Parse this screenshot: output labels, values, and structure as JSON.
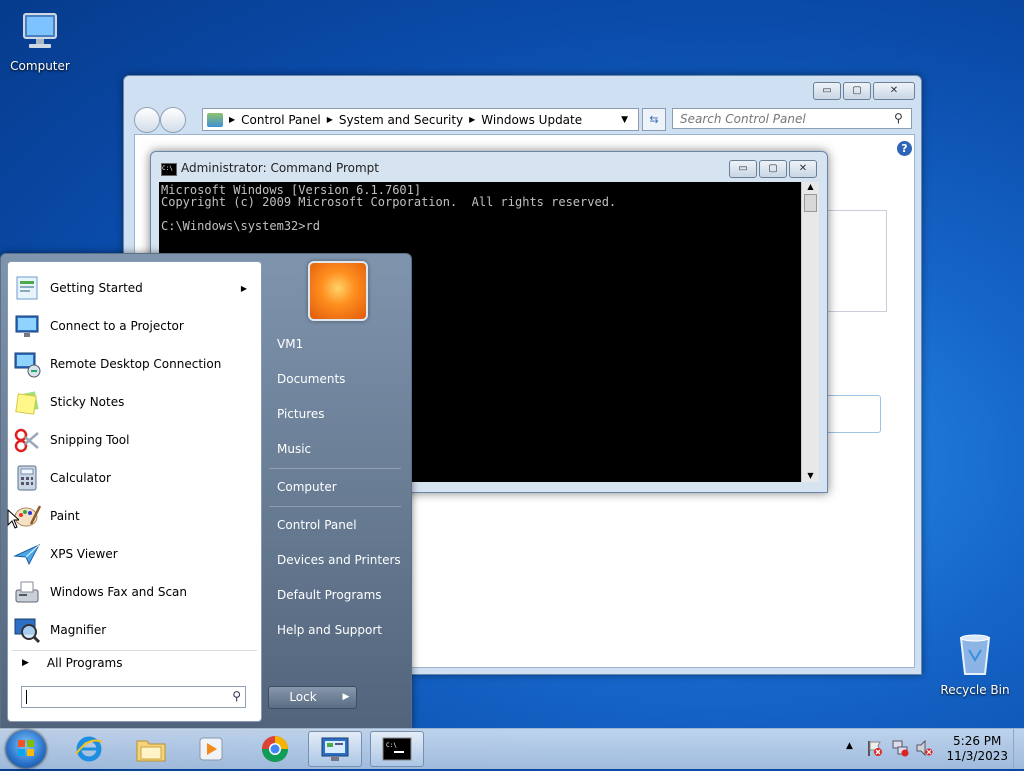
{
  "desktop": {
    "icons": {
      "computer": "Computer",
      "recycle_bin": "Recycle Bin"
    }
  },
  "control_panel": {
    "breadcrumb": [
      "Control Panel",
      "System and Security",
      "Windows Update"
    ],
    "search_placeholder": "Search Control Panel",
    "controls": {
      "minimize": "▭",
      "maximize": "▢",
      "close": "✕"
    }
  },
  "cmd": {
    "title": "Administrator: Command Prompt",
    "console": "Microsoft Windows [Version 6.1.7601]\nCopyright (c) 2009 Microsoft Corporation.  All rights reserved.\n\nC:\\Windows\\system32>rd"
  },
  "start_menu": {
    "programs": [
      {
        "label": "Getting Started",
        "icon": "getting-started-icon",
        "has_submenu": true
      },
      {
        "label": "Connect to a Projector",
        "icon": "projector-icon"
      },
      {
        "label": "Remote Desktop Connection",
        "icon": "remote-desktop-icon"
      },
      {
        "label": "Sticky Notes",
        "icon": "sticky-notes-icon"
      },
      {
        "label": "Snipping Tool",
        "icon": "snipping-tool-icon"
      },
      {
        "label": "Calculator",
        "icon": "calculator-icon"
      },
      {
        "label": "Paint",
        "icon": "paint-icon"
      },
      {
        "label": "XPS Viewer",
        "icon": "xps-viewer-icon"
      },
      {
        "label": "Windows Fax and Scan",
        "icon": "fax-scan-icon"
      },
      {
        "label": "Magnifier",
        "icon": "magnifier-icon"
      }
    ],
    "all_programs": "All Programs",
    "right": {
      "user": "VM1",
      "documents": "Documents",
      "pictures": "Pictures",
      "music": "Music",
      "computer": "Computer",
      "control_panel": "Control Panel",
      "devices": "Devices and Printers",
      "default_programs": "Default Programs",
      "help": "Help and Support"
    },
    "lock": "Lock"
  },
  "taskbar": {
    "time": "5:26 PM",
    "date": "11/3/2023"
  }
}
